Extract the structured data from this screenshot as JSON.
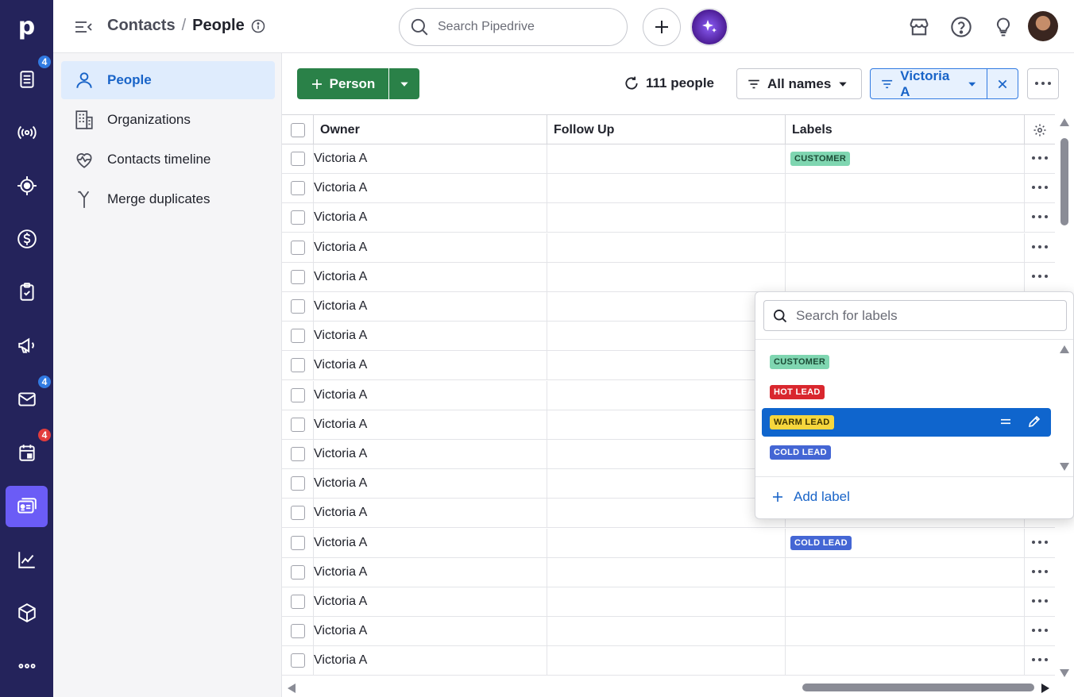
{
  "app": {
    "logo": "p",
    "rail": [
      {
        "icon": "leads-inbox-icon",
        "badge": "4",
        "badge_color": "#317ae2"
      },
      {
        "icon": "broadcast-icon"
      },
      {
        "icon": "target-icon"
      },
      {
        "icon": "dollar-icon"
      },
      {
        "icon": "checklist-icon"
      },
      {
        "icon": "megaphone-icon"
      },
      {
        "icon": "mail-icon",
        "badge": "4",
        "badge_color": "#317ae2"
      },
      {
        "icon": "calendar-icon",
        "badge": "4",
        "badge_color": "#e23c3c"
      },
      {
        "icon": "contacts-card-icon",
        "active": true
      },
      {
        "icon": "chart-icon"
      },
      {
        "icon": "box-icon"
      },
      {
        "icon": "more-icon"
      }
    ]
  },
  "topbar": {
    "breadcrumb_parent": "Contacts",
    "breadcrumb_sep": "/",
    "breadcrumb_current": "People",
    "search_placeholder": "Search Pipedrive"
  },
  "subnav": {
    "items": [
      {
        "label": "People",
        "icon": "person-icon",
        "active": true
      },
      {
        "label": "Organizations",
        "icon": "building-icon"
      },
      {
        "label": "Contacts timeline",
        "icon": "heart-pulse-icon"
      },
      {
        "label": "Merge duplicates",
        "icon": "merge-icon"
      }
    ]
  },
  "toolbar": {
    "add_person_label": "Person",
    "count_label": "111 people",
    "filter_names_label": "All names",
    "filter_owner_label": "Victoria A"
  },
  "table": {
    "columns": [
      "Owner",
      "Follow Up",
      "Labels"
    ],
    "rows": [
      {
        "owner": "Victoria A",
        "label": "CUSTOMER",
        "label_type": "customer"
      },
      {
        "owner": "Victoria A",
        "label": ""
      },
      {
        "owner": "Victoria A",
        "label": ""
      },
      {
        "owner": "Victoria A",
        "label": ""
      },
      {
        "owner": "Victoria A",
        "label": ""
      },
      {
        "owner": "Victoria A",
        "label": ""
      },
      {
        "owner": "Victoria A",
        "label": ""
      },
      {
        "owner": "Victoria A",
        "label": ""
      },
      {
        "owner": "Victoria A",
        "label": ""
      },
      {
        "owner": "Victoria A",
        "label": ""
      },
      {
        "owner": "Victoria A",
        "label": ""
      },
      {
        "owner": "Victoria A",
        "label": ""
      },
      {
        "owner": "Victoria A",
        "label": ""
      },
      {
        "owner": "Victoria A",
        "label": "COLD LEAD",
        "label_type": "cold"
      },
      {
        "owner": "Victoria A",
        "label": ""
      },
      {
        "owner": "Victoria A",
        "label": ""
      },
      {
        "owner": "Victoria A",
        "label": ""
      },
      {
        "owner": "Victoria A",
        "label": ""
      }
    ]
  },
  "label_dropdown": {
    "search_placeholder": "Search for labels",
    "options": [
      {
        "label": "CUSTOMER",
        "type": "customer"
      },
      {
        "label": "HOT LEAD",
        "type": "hot"
      },
      {
        "label": "WARM LEAD",
        "type": "warm",
        "highlighted": true
      },
      {
        "label": "COLD LEAD",
        "type": "cold"
      }
    ],
    "add_label": "Add label"
  },
  "colors": {
    "rail_bg": "#24235b",
    "rail_active": "#6b5cf6",
    "primary_green": "#2a8148",
    "accent_blue": "#1964c8",
    "highlight_blue": "#0f65cd"
  }
}
